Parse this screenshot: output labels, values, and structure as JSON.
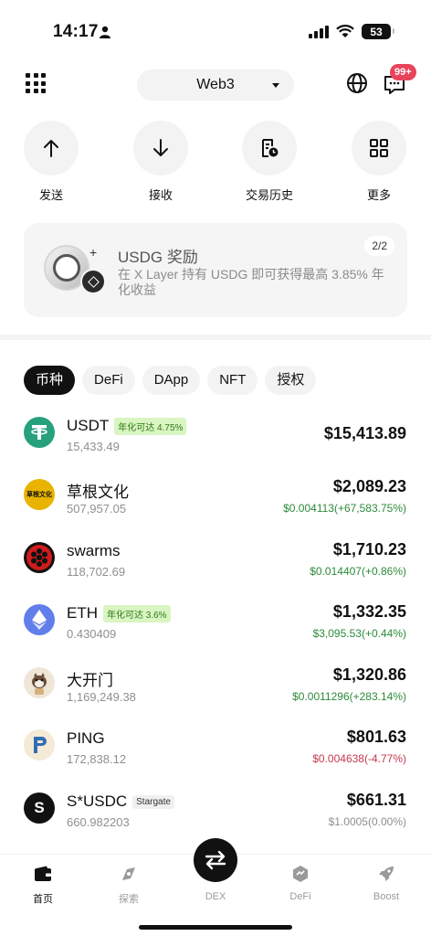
{
  "status": {
    "time": "14:17",
    "battery": "53"
  },
  "header": {
    "network": "Web3",
    "message_badge": "99+"
  },
  "actions": [
    {
      "label": "发送",
      "icon": "arrow-up-icon"
    },
    {
      "label": "接收",
      "icon": "arrow-down-icon"
    },
    {
      "label": "交易历史",
      "icon": "history-icon"
    },
    {
      "label": "更多",
      "icon": "grid-more-icon"
    }
  ],
  "reward": {
    "title": "USDG 奖励",
    "description": "在 X Layer 持有 USDG 即可获得最高 3.85% 年化收益",
    "page": "2/2"
  },
  "tabs": [
    {
      "label": "币种",
      "active": true
    },
    {
      "label": "DeFi",
      "active": false
    },
    {
      "label": "DApp",
      "active": false
    },
    {
      "label": "NFT",
      "active": false
    },
    {
      "label": "授权",
      "active": false
    }
  ],
  "assets": [
    {
      "name": "USDT",
      "tag": "年化可达 4.75%",
      "amount": "15,433.49",
      "value": "$15,413.89",
      "change": "",
      "icon": "usdt-icon",
      "color": "#26a17b"
    },
    {
      "name": "草根文化",
      "tag": "",
      "amount": "507,957.05",
      "value": "$2,089.23",
      "change": "$0.004113(+67,583.75%)",
      "icon": "caogen-icon",
      "color": "#e8b400"
    },
    {
      "name": "swarms",
      "tag": "",
      "amount": "118,702.69",
      "value": "$1,710.23",
      "change": "$0.014407(+0.86%)",
      "icon": "swarms-icon",
      "color": "#d01c1c"
    },
    {
      "name": "ETH",
      "tag": "年化可达 3.6%",
      "amount": "0.430409",
      "value": "$1,332.35",
      "change": "$3,095.53(+0.44%)",
      "icon": "eth-icon",
      "color": "#627eea"
    },
    {
      "name": "大开门",
      "tag": "",
      "amount": "1,169,249.38",
      "value": "$1,320.86",
      "change": "$0.0011296(+283.14%)",
      "icon": "dakaimen-icon",
      "color": "#f0e6d8"
    },
    {
      "name": "PING",
      "tag": "",
      "amount": "172,838.12",
      "value": "$801.63",
      "change": "$0.004638(-4.77%)",
      "icon": "ping-icon",
      "color": "#f4ead6"
    },
    {
      "name": "S*USDC",
      "tag": "Stargate",
      "amount": "660.982203",
      "value": "$661.31",
      "change": "$1.0005(0.00%)",
      "icon": "susdc-icon",
      "color": "#111111"
    }
  ],
  "nav": [
    {
      "label": "首页",
      "icon": "wallet-icon",
      "active": true
    },
    {
      "label": "探索",
      "icon": "compass-icon",
      "active": false
    },
    {
      "label": "DEX",
      "icon": "swap-icon",
      "active": false
    },
    {
      "label": "DeFi",
      "icon": "defi-icon",
      "active": false
    },
    {
      "label": "Boost",
      "icon": "rocket-icon",
      "active": false
    }
  ]
}
